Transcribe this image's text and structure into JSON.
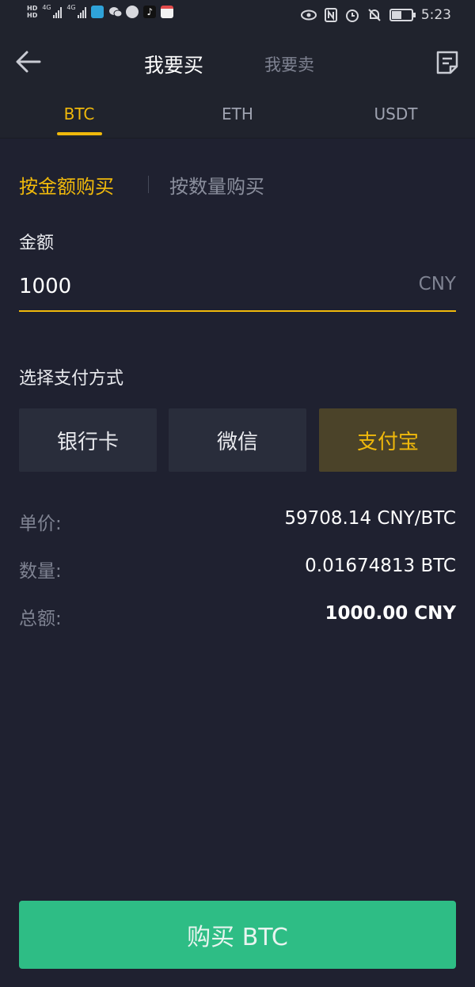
{
  "status_bar": {
    "hd1": "HD",
    "hd2": "HD",
    "net1": "4G",
    "net2": "4G",
    "time": "5:23",
    "battery_level": 0.5,
    "icons": [
      "telegram-icon",
      "wechat-icon",
      "location-icon",
      "tiktok-icon",
      "app-icon",
      "eye-icon",
      "nfc-icon",
      "alarm-icon",
      "mute-icon",
      "battery-icon"
    ]
  },
  "header": {
    "buy_tab": "我要买",
    "sell_tab": "我要卖"
  },
  "coin_tabs": [
    {
      "label": "BTC",
      "active": true
    },
    {
      "label": "ETH",
      "active": false
    },
    {
      "label": "USDT",
      "active": false
    }
  ],
  "buy_mode": {
    "by_amount": "按金额购买",
    "by_quantity": "按数量购买"
  },
  "amount": {
    "label": "金额",
    "value": "1000",
    "unit": "CNY"
  },
  "payment": {
    "label": "选择支付方式",
    "options": [
      {
        "label": "银行卡",
        "selected": false
      },
      {
        "label": "微信",
        "selected": false
      },
      {
        "label": "支付宝",
        "selected": true
      }
    ]
  },
  "summary": {
    "price_label": "单价:",
    "price_value": "59708.14 CNY/BTC",
    "qty_label": "数量:",
    "qty_value": "0.01674813 BTC",
    "total_label": "总额:",
    "total_value": "1000.00 CNY"
  },
  "buy_button": "购买 BTC",
  "colors": {
    "accent": "#f0b90b",
    "buy_green": "#2ebd85",
    "background": "#1f2130"
  }
}
